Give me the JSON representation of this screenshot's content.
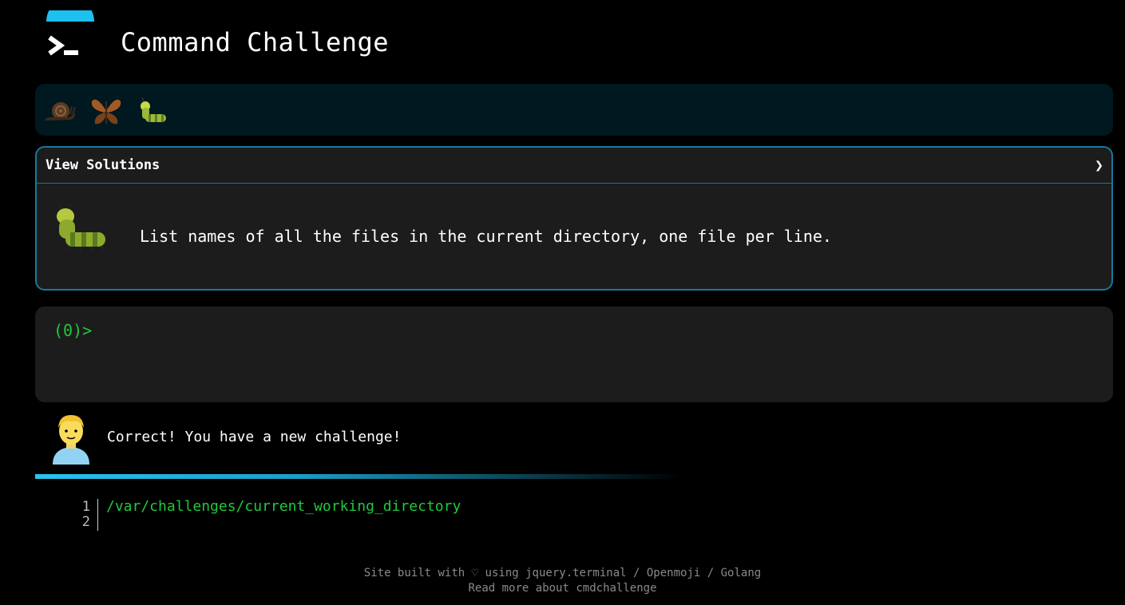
{
  "header": {
    "title": "Command Challenge",
    "logo_icon": "terminal-prompt-icon"
  },
  "badges": [
    {
      "name": "snail-icon"
    },
    {
      "name": "butterfly-icon"
    },
    {
      "name": "caterpillar-icon"
    }
  ],
  "panel": {
    "toggle_label": "View Solutions",
    "chevron": "❯",
    "icon": "caterpillar-icon",
    "challenge_text": "List names of all the files in the current directory, one file per line."
  },
  "terminal": {
    "prompt": "(0)>"
  },
  "message": {
    "avatar_icon": "person-icon",
    "text": "Correct! You have a new challenge!"
  },
  "output": {
    "line_numbers": [
      "1",
      "2"
    ],
    "lines": [
      "/var/challenges/current_working_directory",
      ""
    ]
  },
  "footer": {
    "prefix": "Site built with",
    "heart": "♡",
    "using": "using",
    "link_jquery": "jquery.terminal",
    "sep1": "/",
    "link_openmoji": "Openmoji",
    "sep2": "/",
    "link_golang": "Golang",
    "read_more_prefix": "Read more about",
    "read_more_link": "cmdchallenge"
  },
  "colors": {
    "accent": "#1578a0",
    "prompt_green": "#21c83e",
    "badge_bar_bg": "#001820",
    "panel_bg": "#1c1c1c"
  }
}
